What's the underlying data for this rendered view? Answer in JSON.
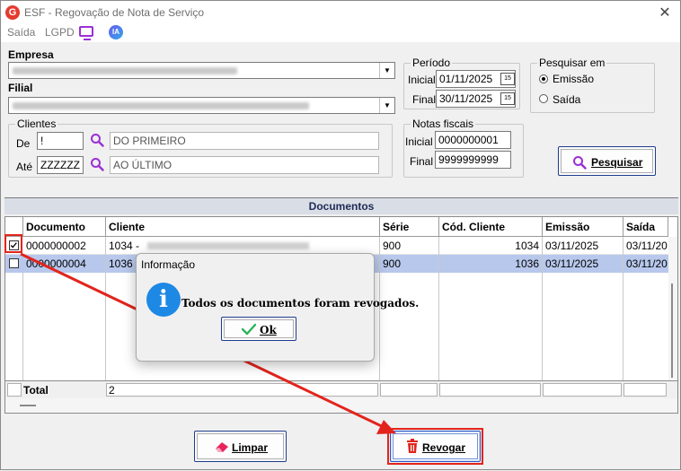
{
  "window": {
    "title": "ESF - Regovação de Nota de Serviço",
    "close_glyph": "✕",
    "app_icon_letter": "G"
  },
  "menu": {
    "items": [
      "Saída",
      "LGPD"
    ],
    "ia_label": "IA"
  },
  "form": {
    "empresa_label": "Empresa",
    "filial_label": "Filial",
    "periodo": {
      "title": "Período",
      "inicial_label": "Inicial",
      "inicial_value": "01/11/2025",
      "final_label": "Final",
      "final_value": "30/11/2025",
      "cal_glyph": "15"
    },
    "pesquisar_em": {
      "title": "Pesquisar em",
      "options": [
        "Emissão",
        "Saída"
      ],
      "selected": "Emissão"
    },
    "clientes": {
      "title": "Clientes",
      "de_label": "De",
      "de_value": "!",
      "de_desc": "DO PRIMEIRO",
      "ate_label": "Até",
      "ate_value": "ZZZZZZ",
      "ate_desc": "AO ÚLTIMO"
    },
    "notas": {
      "title": "Notas fiscais",
      "inicial_label": "Inicial",
      "inicial_value": "0000000001",
      "final_label": "Final",
      "final_value": "9999999999"
    },
    "pesquisar_button": "Pesquisar"
  },
  "documents": {
    "section_title": "Documentos",
    "columns": [
      "Documento",
      "Cliente",
      "Série",
      "Cód. Cliente",
      "Emissão",
      "Saída"
    ],
    "rows": [
      {
        "checked": true,
        "documento": "0000000002",
        "cliente": "1034 -",
        "serie": "900",
        "cod_cliente": "1034",
        "emissao": "03/11/2025",
        "saida": "03/11/20"
      },
      {
        "checked": false,
        "documento": "0000000004",
        "cliente": "1036 -",
        "serie": "900",
        "cod_cliente": "1036",
        "emissao": "03/11/2025",
        "saida": "03/11/20"
      }
    ],
    "total_label": "Total",
    "total_value": "2"
  },
  "dialog": {
    "title": "Informação",
    "message": "Todos os documentos foram revogados.",
    "ok_label": "Ok",
    "info_glyph": "i"
  },
  "buttons": {
    "limpar": "Limpar",
    "revogar": "Revogar"
  },
  "colors": {
    "accent": "#1e3c8c",
    "selected_row": "#b8c8ec",
    "annotation": "#e3241c",
    "search_icon": "#9b2fd6"
  }
}
